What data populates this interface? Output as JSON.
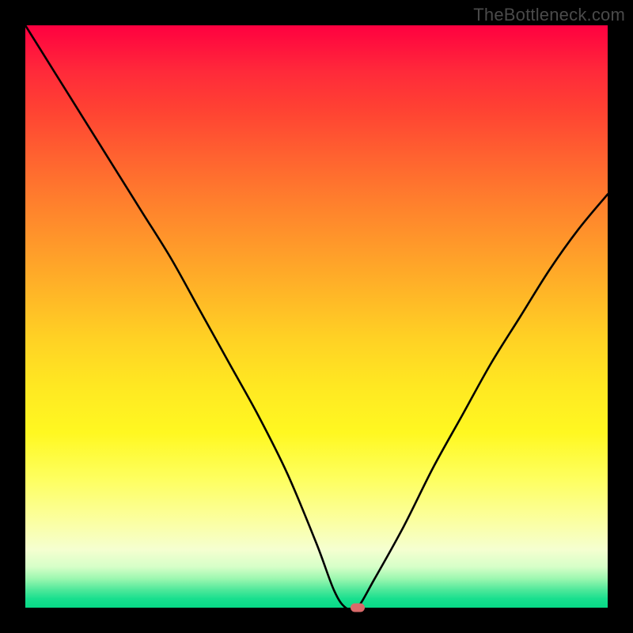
{
  "watermark": "TheBottleneck.com",
  "chart_data": {
    "type": "line",
    "title": "",
    "xlabel": "",
    "ylabel": "",
    "xlim": [
      0,
      100
    ],
    "ylim": [
      0,
      100
    ],
    "x": [
      0,
      5,
      10,
      15,
      20,
      25,
      30,
      35,
      40,
      45,
      50,
      53,
      55,
      57,
      60,
      65,
      70,
      75,
      80,
      85,
      90,
      95,
      100
    ],
    "values": [
      100,
      92,
      84,
      76,
      68,
      60,
      51,
      42,
      33,
      23,
      11,
      3,
      0,
      0,
      5,
      14,
      24,
      33,
      42,
      50,
      58,
      65,
      71
    ],
    "marker": {
      "x": 57,
      "y": 0
    },
    "gradient_stops": [
      {
        "pos": 0.0,
        "color": "#ff0040"
      },
      {
        "pos": 0.5,
        "color": "#ffb627"
      },
      {
        "pos": 0.8,
        "color": "#fbffa0"
      },
      {
        "pos": 1.0,
        "color": "#07d986"
      }
    ]
  }
}
